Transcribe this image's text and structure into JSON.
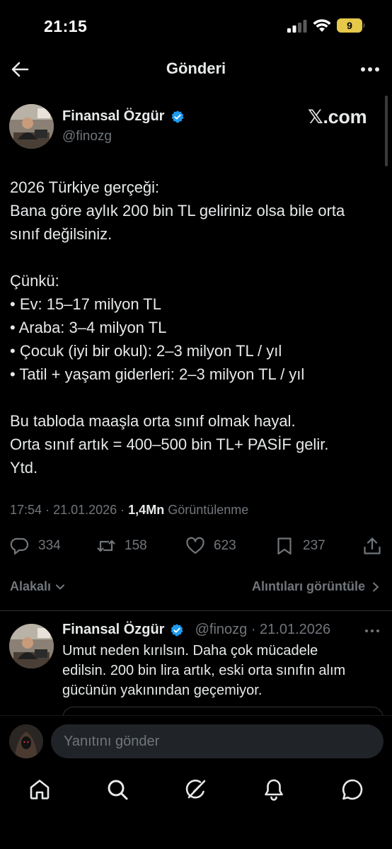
{
  "status_bar": {
    "time": "21:15",
    "battery": "9",
    "battery_level": 0.09,
    "battery_color": "#e6c84a"
  },
  "header": {
    "title": "Gönderi",
    "back_icon": "arrow-left-icon",
    "more_icon": "more-horizontal-icon"
  },
  "post": {
    "author_name": "Finansal Özgür",
    "author_handle": "@finozg",
    "verified_color": "#1d9bf0",
    "source_logo": "𝕏.com",
    "lines": [
      "2026 Türkiye gerçeği:",
      "Bana göre aylık 200 bin TL geliriniz olsa bile orta",
      "sınıf değilsiniz.",
      "",
      "Çünkü:",
      "• Ev: 15–17 milyon TL",
      "• Araba: 3–4 milyon TL",
      "• Çocuk (iyi bir okul): 2–3 milyon TL / yıl",
      "• Tatil + yaşam giderleri: 2–3 milyon TL / yıl",
      "",
      "Bu tabloda maaşla orta sınıf olmak hayal.",
      "Orta sınıf artık = 400–500 bin TL+ PASİF gelir.",
      "Ytd."
    ],
    "time": "17:54",
    "date": "21.01.2026",
    "views_count": "1,4Mn",
    "views_label": "Görüntülenme",
    "replies": "334",
    "reposts": "158",
    "likes": "623",
    "bookmarks": "237"
  },
  "sort": {
    "left_label": "Alakalı",
    "right_label": "Alıntıları görüntüle"
  },
  "reply": {
    "author_name": "Finansal Özgür",
    "author_handle": "@finozg",
    "date": "21.01.2026",
    "lines": [
      "Umut neden kırılsın. Daha çok mücadele",
      "edilsin. 200 bin lira artık, eski orta sınıfın alım",
      "gücünün yakınından geçemiyor."
    ]
  },
  "composer": {
    "placeholder": "Yanıtını gönder"
  },
  "nav": {
    "items": [
      "home-icon",
      "search-icon",
      "grok-icon",
      "notifications-icon",
      "messages-icon"
    ]
  }
}
